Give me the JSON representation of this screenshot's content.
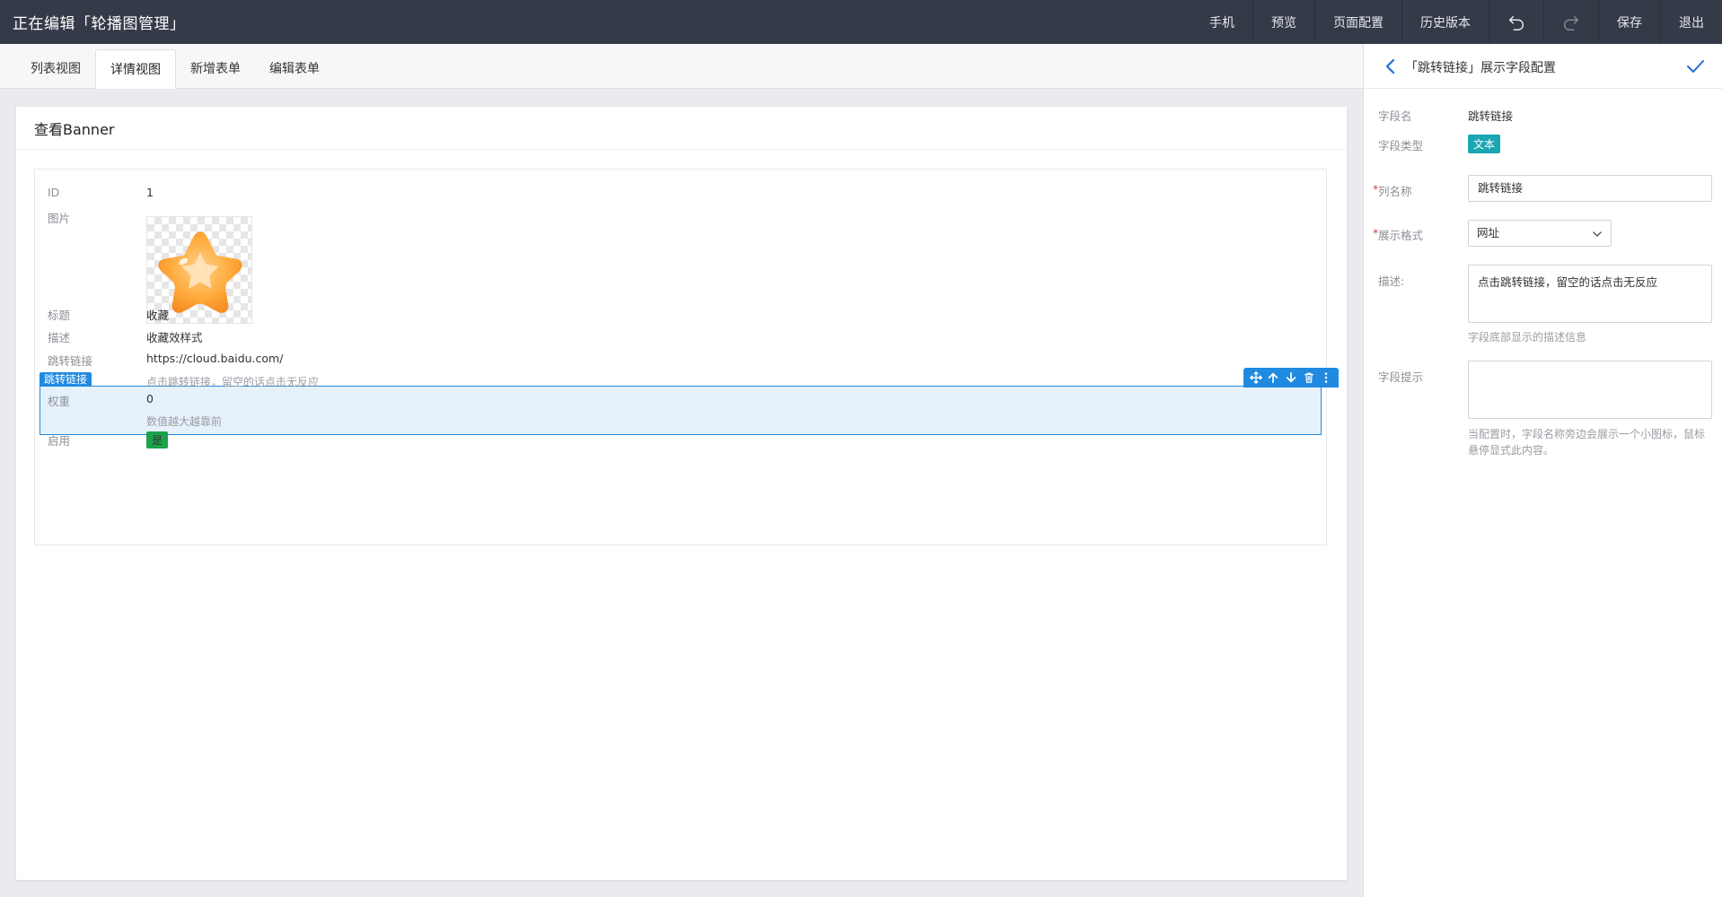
{
  "header": {
    "title": "正在编辑「轮播图管理」",
    "actions": [
      "手机",
      "预览",
      "页面配置",
      "历史版本"
    ],
    "undo_icon": "undo-icon",
    "redo_icon": "redo-icon",
    "save_label": "保存",
    "exit_label": "退出"
  },
  "tabs": [
    {
      "label": "列表视图",
      "active": false
    },
    {
      "label": "详情视图",
      "active": true
    },
    {
      "label": "新增表单",
      "active": false
    },
    {
      "label": "编辑表单",
      "active": false
    }
  ],
  "detail": {
    "title": "查看Banner",
    "fields": {
      "id": {
        "label": "ID",
        "value": "1"
      },
      "image": {
        "label": "图片",
        "image_icon": "star-icon"
      },
      "title": {
        "label": "标题",
        "value": "收藏"
      },
      "desc": {
        "label": "描述",
        "value": "收藏效样式"
      },
      "link": {
        "label": "跳转链接",
        "value": "https://cloud.baidu.com/",
        "hint": "点击跳转链接，留空的话点击无反应"
      },
      "weight": {
        "label": "权重",
        "value": "0",
        "hint": "数值越大越靠前"
      },
      "enabled": {
        "label": "启用",
        "value": "是"
      }
    },
    "selected_tag": "跳转链接",
    "toolbar_icons": [
      "move-icon",
      "arrow-up-icon",
      "arrow-down-icon",
      "trash-icon",
      "more-icon"
    ]
  },
  "config": {
    "title": "「跳转链接」展示字段配置",
    "field_name_label": "字段名",
    "field_name_value": "跳转链接",
    "field_type_label": "字段类型",
    "field_type_value": "文本",
    "column_label": "列名称",
    "column_value": "跳转链接",
    "format_label": "展示格式",
    "format_value": "网址",
    "desc_label": "描述:",
    "desc_value": "点击跳转链接，留空的话点击无反应",
    "desc_help": "字段底部显示的描述信息",
    "tip_label": "字段提示",
    "tip_value": "",
    "tip_help": "当配置时，字段名称旁边会展示一个小图标，鼠标悬停显式此内容。"
  },
  "colors": {
    "header_bg": "#343a48",
    "accent": "#1f8ae0",
    "type_badge": "#1ba6b3",
    "yes_badge": "#1aa34a"
  }
}
